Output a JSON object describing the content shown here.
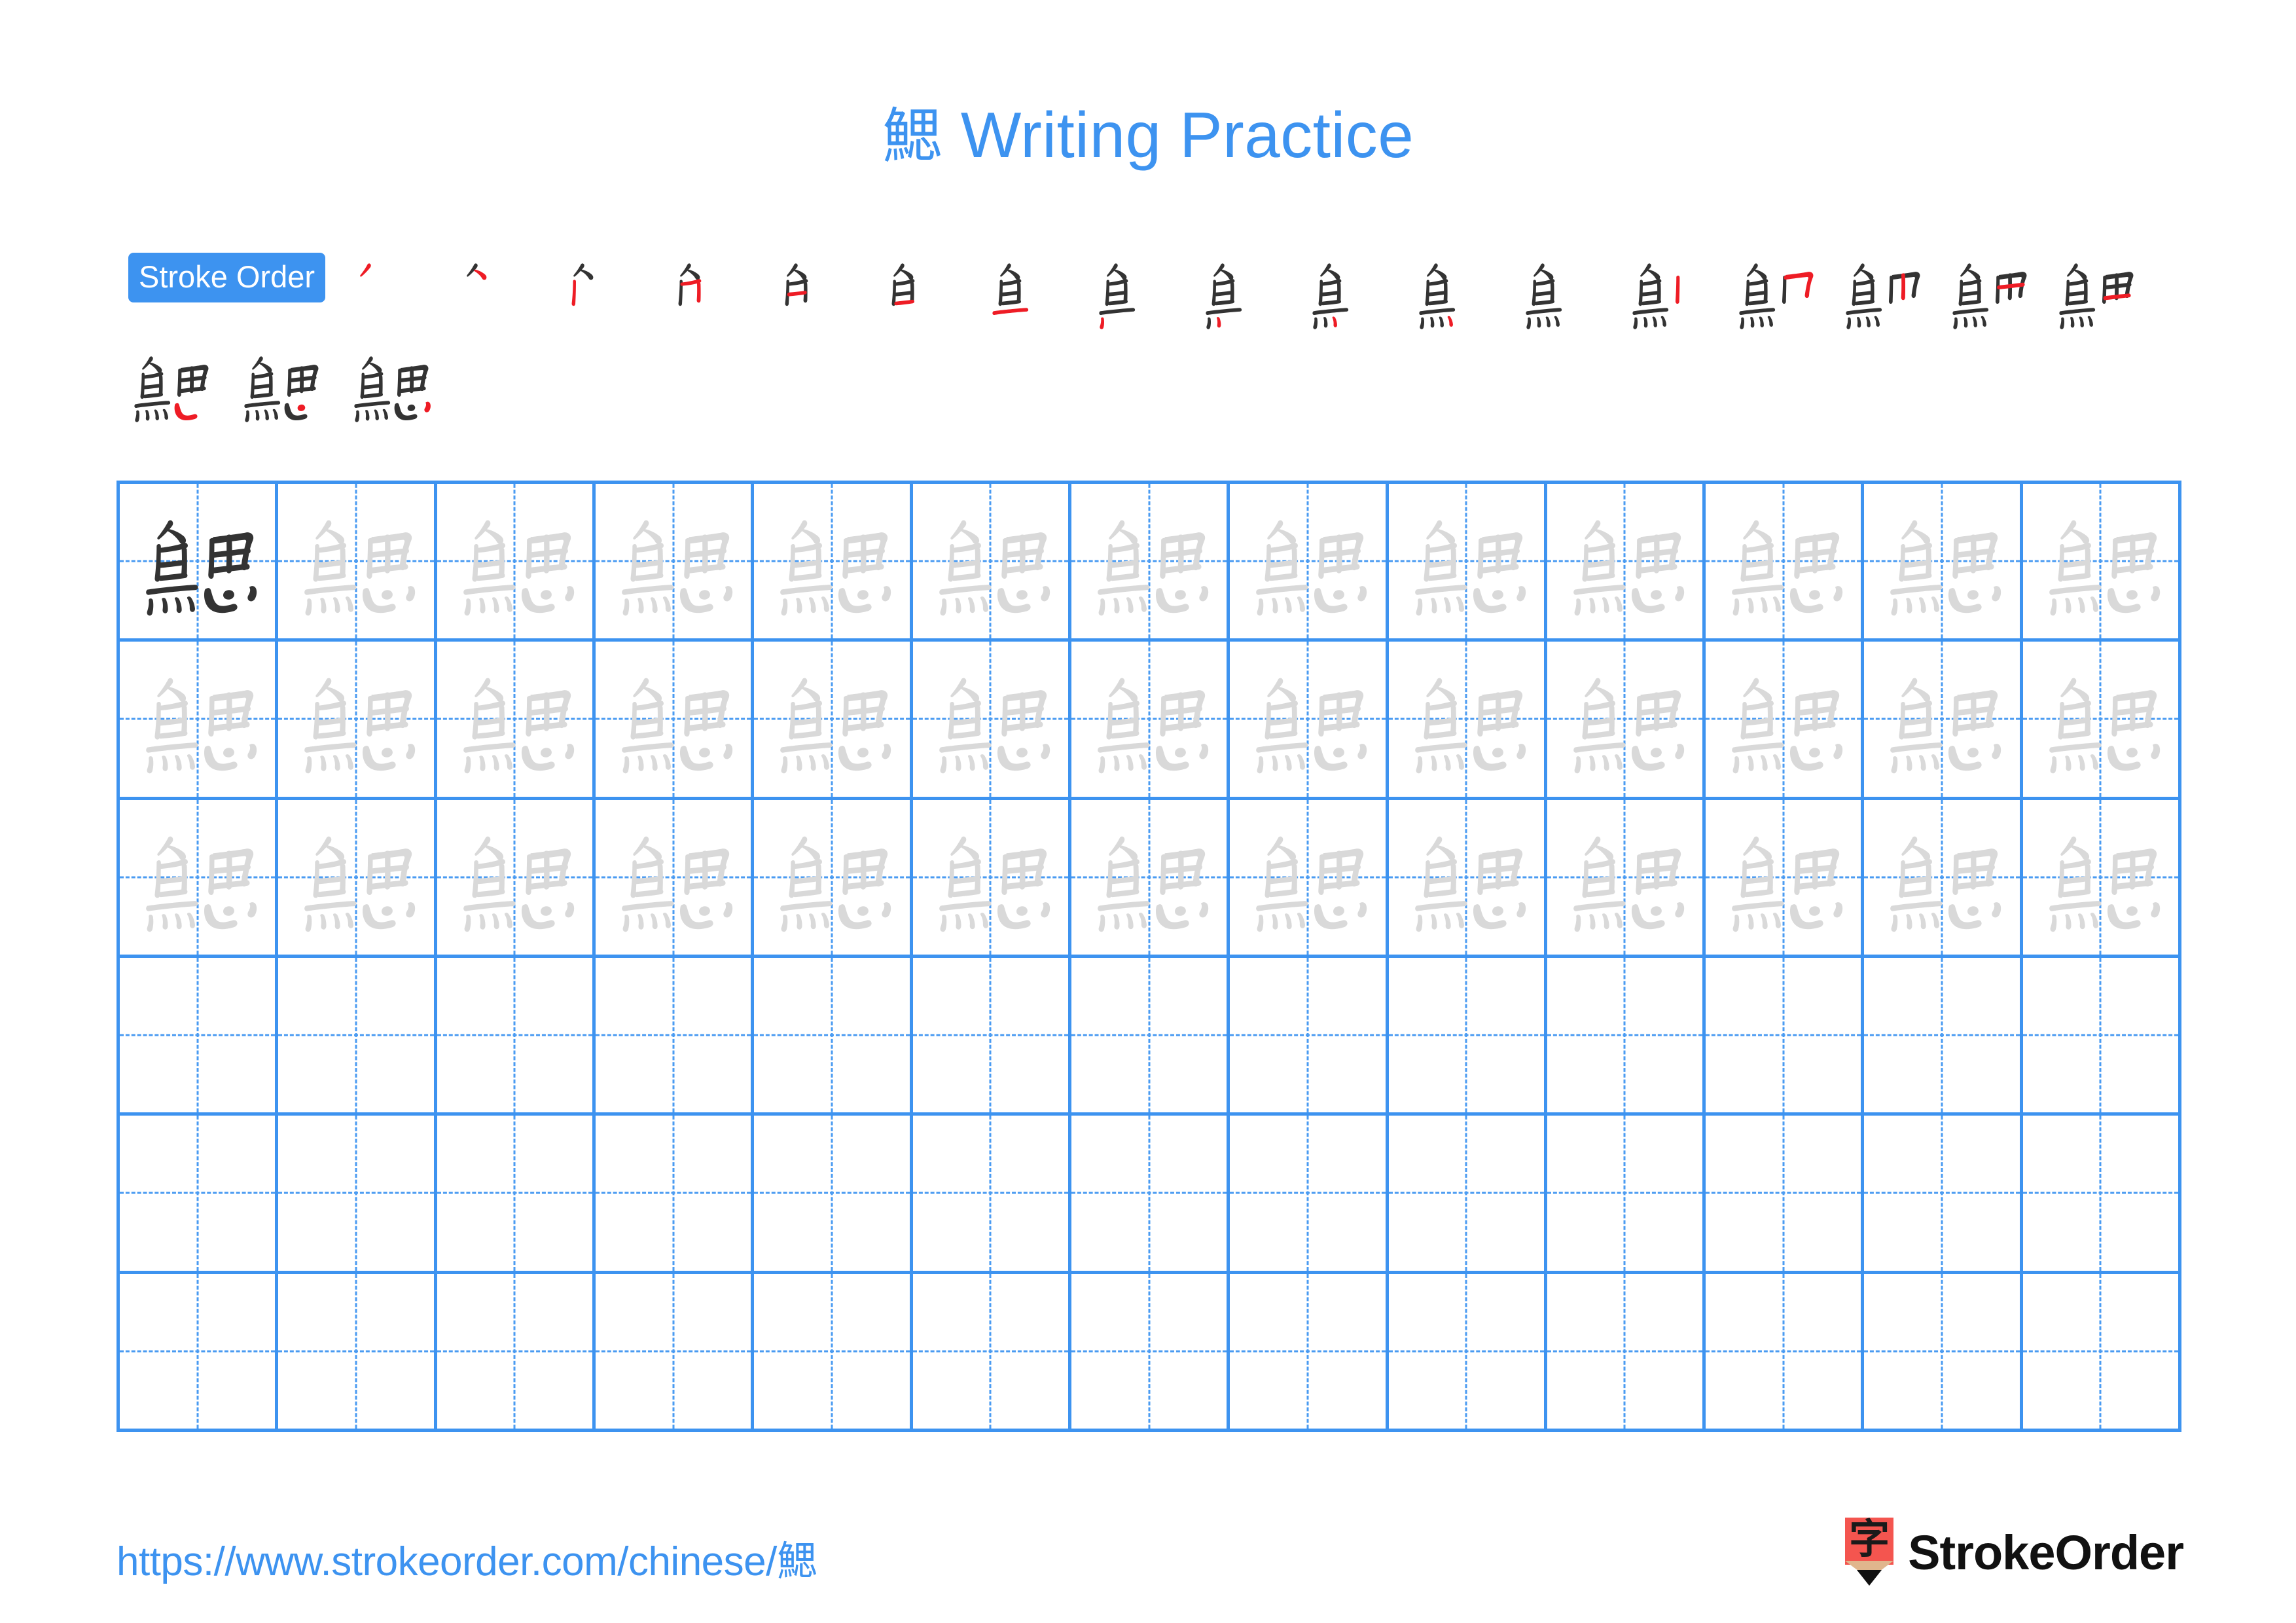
{
  "character": "鰓",
  "title": {
    "character": "鰓",
    "suffix": " Writing Practice",
    "full": "鰓 Writing Practice",
    "color": "#3d93f0"
  },
  "stroke_order": {
    "badge_label": "Stroke Order",
    "badge_bg": "#3d93f0",
    "badge_text_color": "#ffffff",
    "total_strokes": 20,
    "new_stroke_color": "#ee1c25",
    "existing_stroke_color": "#333333",
    "row1_count": 17,
    "row2_count": 3,
    "steps": [
      {
        "index": 1,
        "partial": "丿"
      },
      {
        "index": 2,
        "partial": "ク"
      },
      {
        "index": 3,
        "partial": "ク"
      },
      {
        "index": 4,
        "partial": "夕"
      },
      {
        "index": 5,
        "partial": "臽"
      },
      {
        "index": 6,
        "partial": "角"
      },
      {
        "index": 7,
        "partial": "角"
      },
      {
        "index": 8,
        "partial": "魚"
      },
      {
        "index": 9,
        "partial": "魚"
      },
      {
        "index": 10,
        "partial": "魚"
      },
      {
        "index": 11,
        "partial": "魚"
      },
      {
        "index": 12,
        "partial": "魚"
      },
      {
        "index": 13,
        "partial": "魚"
      },
      {
        "index": 14,
        "partial": "鮄"
      },
      {
        "index": 15,
        "partial": "鮋"
      },
      {
        "index": 16,
        "partial": "鮔"
      },
      {
        "index": 17,
        "partial": "鮋"
      },
      {
        "index": 18,
        "partial": "鰓"
      },
      {
        "index": 19,
        "partial": "鰓"
      },
      {
        "index": 20,
        "partial": "鰓"
      }
    ]
  },
  "practice_grid": {
    "rows": 6,
    "columns": 13,
    "grid_line_color": "#3d93f0",
    "guide_line_color": "#4a9bf2",
    "dark_char_color": "#333333",
    "ghost_char_color": "#d9d9d9",
    "cells": [
      [
        "dark",
        "ghost",
        "ghost",
        "ghost",
        "ghost",
        "ghost",
        "ghost",
        "ghost",
        "ghost",
        "ghost",
        "ghost",
        "ghost",
        "ghost"
      ],
      [
        "ghost",
        "ghost",
        "ghost",
        "ghost",
        "ghost",
        "ghost",
        "ghost",
        "ghost",
        "ghost",
        "ghost",
        "ghost",
        "ghost",
        "ghost"
      ],
      [
        "ghost",
        "ghost",
        "ghost",
        "ghost",
        "ghost",
        "ghost",
        "ghost",
        "ghost",
        "ghost",
        "ghost",
        "ghost",
        "ghost",
        "ghost"
      ],
      [
        "empty",
        "empty",
        "empty",
        "empty",
        "empty",
        "empty",
        "empty",
        "empty",
        "empty",
        "empty",
        "empty",
        "empty",
        "empty"
      ],
      [
        "empty",
        "empty",
        "empty",
        "empty",
        "empty",
        "empty",
        "empty",
        "empty",
        "empty",
        "empty",
        "empty",
        "empty",
        "empty"
      ],
      [
        "empty",
        "empty",
        "empty",
        "empty",
        "empty",
        "empty",
        "empty",
        "empty",
        "empty",
        "empty",
        "empty",
        "empty",
        "empty"
      ]
    ]
  },
  "footer": {
    "url": "https://www.strokeorder.com/chinese/鰓",
    "url_color": "#3d93f0",
    "brand_name": "StrokeOrder",
    "brand_icon_char": "字",
    "brand_icon_bg": "#f4554f",
    "brand_icon_wood": "#e0b68d",
    "brand_icon_tip": "#111111",
    "brand_text_color": "#111111"
  }
}
